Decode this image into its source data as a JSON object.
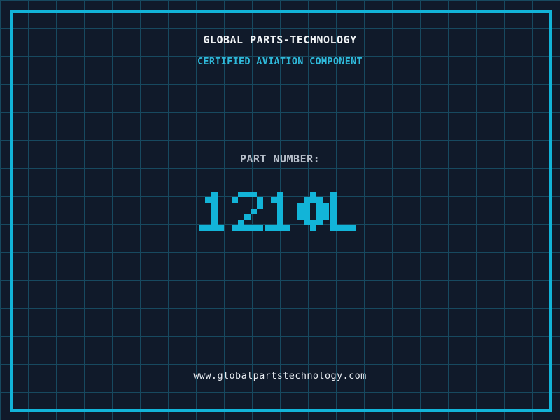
{
  "theme": {
    "background": "#101a2a",
    "grid_line": "#17495f",
    "accent": "#12b4d8",
    "title_color": "#f2f5f7",
    "subtitle_color": "#2fb9da",
    "label_color": "#b8c0cb",
    "url_color": "#e9edf2"
  },
  "header": {
    "company": "GLOBAL PARTS-TECHNOLOGY",
    "tagline": "CERTIFIED AVIATION COMPONENT"
  },
  "part": {
    "label": "PART NUMBER:",
    "number": "1210L"
  },
  "footer": {
    "website": "www.globalpartstechnology.com"
  }
}
